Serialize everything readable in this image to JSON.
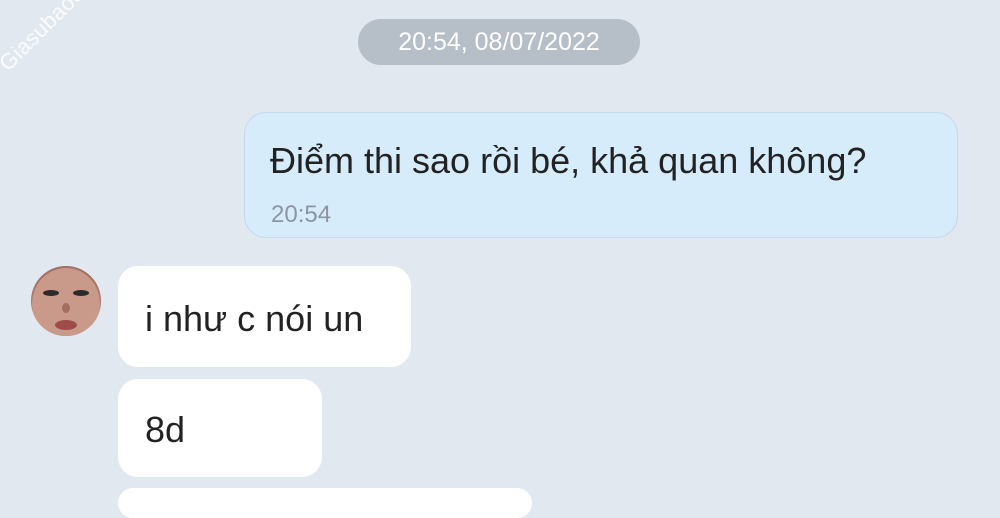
{
  "watermark": "Giasubaochau.net",
  "chat": {
    "timestamp_pill": "20:54, 08/07/2022",
    "sent_message": {
      "text": "Điểm thi sao rồi bé, khả quan không?",
      "time": "20:54"
    },
    "received_messages": [
      {
        "text": "i như c nói un"
      },
      {
        "text": "8d"
      },
      {
        "text": ""
      }
    ]
  },
  "colors": {
    "background": "#e2e8f0",
    "sent_bubble": "#d6ecfb",
    "received_bubble": "#ffffff",
    "timestamp_pill": "#b6bec8"
  },
  "icons": {
    "avatar": "contact-avatar"
  }
}
